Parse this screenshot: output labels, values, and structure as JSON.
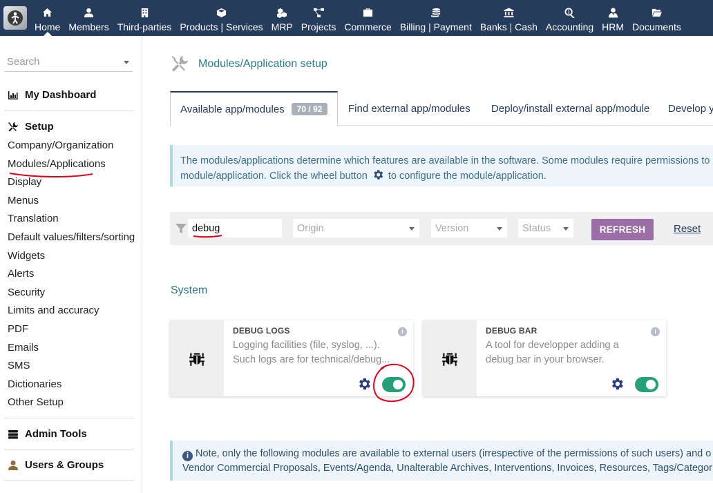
{
  "topbar": {
    "menus": [
      {
        "label": "Home",
        "icon": "home-icon",
        "active": true
      },
      {
        "label": "Members",
        "icon": "user-icon"
      },
      {
        "label": "Third-parties",
        "icon": "building-icon"
      },
      {
        "label": "Products | Services",
        "icon": "cube-icon"
      },
      {
        "label": "MRP",
        "icon": "cubes-icon"
      },
      {
        "label": "Projects",
        "icon": "project-diagram-icon"
      },
      {
        "label": "Commerce",
        "icon": "suitcase-icon"
      },
      {
        "label": "Billing | Payment",
        "icon": "coins-icon"
      },
      {
        "label": "Banks | Cash",
        "icon": "bank-icon"
      },
      {
        "label": "Accounting",
        "icon": "search-dollar-icon"
      },
      {
        "label": "HRM",
        "icon": "user-tie-icon"
      },
      {
        "label": "Documents",
        "icon": "folder-open-icon"
      }
    ]
  },
  "sidebar": {
    "search_placeholder": "Search",
    "dashboard": "My Dashboard",
    "setup": "Setup",
    "items": [
      "Company/Organization",
      "Modules/Applications",
      "Display",
      "Menus",
      "Translation",
      "Default values/filters/sorting",
      "Widgets",
      "Alerts",
      "Security",
      "Limits and accuracy",
      "PDF",
      "Emails",
      "SMS",
      "Dictionaries",
      "Other Setup"
    ],
    "admin_tools": "Admin Tools",
    "users_groups": "Users & Groups"
  },
  "main": {
    "title": "Modules/Application setup",
    "tabs": [
      {
        "label": "Available app/modules",
        "badge": "70 / 92"
      },
      {
        "label": "Find external app/modules"
      },
      {
        "label": "Deploy/install external app/module"
      },
      {
        "label": "Develop y"
      }
    ],
    "info_line1": "The modules/applications determine which features are available in the software. Some modules require permissions to",
    "info_line2a": "module/application. Click the wheel button",
    "info_line2b": "to configure the module/application.",
    "filter": {
      "keyword": "debug",
      "origin_placeholder": "Origin",
      "version_placeholder": "Version",
      "status_placeholder": "Status",
      "refresh_label": "REFRESH",
      "reset_label": "Reset"
    },
    "section_title": "System",
    "modules": [
      {
        "name": "DEBUG LOGS",
        "description": "Logging facilities (file, syslog, ...). Such logs are for technical/debug...",
        "enabled": true
      },
      {
        "name": "DEBUG BAR",
        "description": "A tool for developper adding a debug bar in your browser.",
        "enabled": true
      }
    ],
    "note_line1": "Note, only the following modules are available to external users (irrespective of the permissions of such users) and o",
    "note_line2": "Vendor Commercial Proposals, Events/Agenda, Unalterable Archives, Interventions, Invoices, Resources, Tags/Categor"
  },
  "colors": {
    "topbar": "#263c5c",
    "accent_teal": "#2c7b86",
    "refresh_button": "#9b6ea6",
    "toggle_on": "#27a07a",
    "annotation": "#e2001a"
  }
}
